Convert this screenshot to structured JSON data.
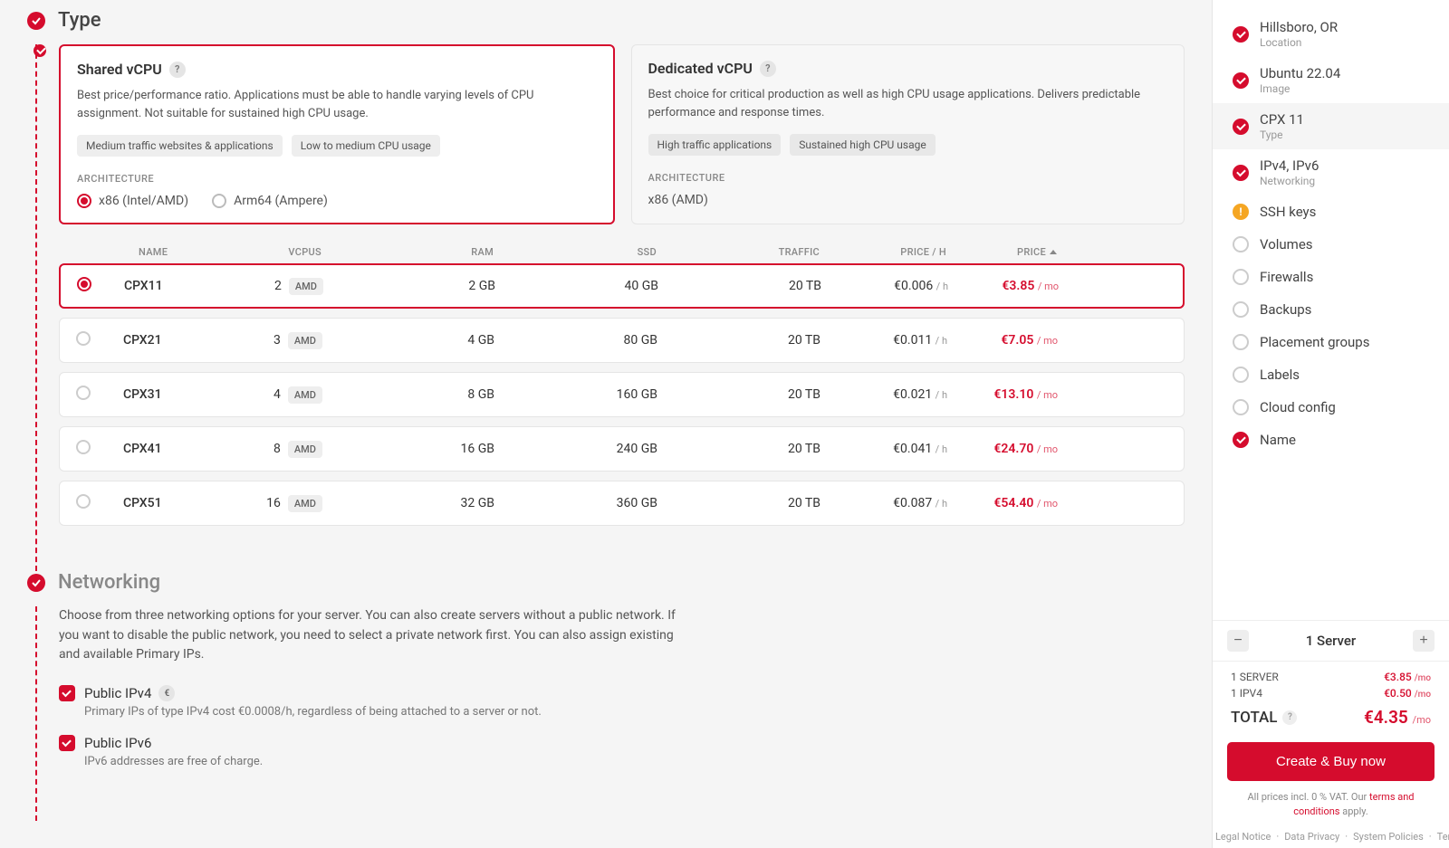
{
  "sections": {
    "type": {
      "title": "Type"
    },
    "networking": {
      "title": "Networking",
      "intro": "Choose from three networking options for your server. You can also create servers without a public network. If you want to disable the public network, you need to select a private network first. You can also assign existing and available Primary IPs.",
      "ipv4": {
        "label": "Public IPv4",
        "sub": "Primary IPs of type IPv4 cost €0.0008/h, regardless of being attached to a server or not."
      },
      "ipv6": {
        "label": "Public IPv6",
        "sub": "IPv6 addresses are free of charge."
      }
    }
  },
  "cards": {
    "shared": {
      "title": "Shared vCPU",
      "desc": "Best price/performance ratio. Applications must be able to handle varying levels of CPU assignment. Not suitable for sustained high CPU usage.",
      "chips": [
        "Medium traffic websites & applications",
        "Low to medium CPU usage"
      ],
      "arch_label": "ARCHITECTURE",
      "arch_opts": [
        "x86 (Intel/AMD)",
        "Arm64 (Ampere)"
      ]
    },
    "dedicated": {
      "title": "Dedicated vCPU",
      "desc": "Best choice for critical production as well as high CPU usage applications. Delivers predictable performance and response times.",
      "chips": [
        "High traffic applications",
        "Sustained high CPU usage"
      ],
      "arch_label": "ARCHITECTURE",
      "arch_single": "x86 (AMD)"
    }
  },
  "table": {
    "headers": {
      "name": "NAME",
      "vcpus": "VCPUS",
      "ram": "RAM",
      "ssd": "SSD",
      "traffic": "TRAFFIC",
      "price_h": "PRICE / H",
      "price": "PRICE"
    },
    "rows": [
      {
        "name": "CPX11",
        "vcpu": "2",
        "vendor": "AMD",
        "ram": "2 GB",
        "ssd": "40 GB",
        "traffic": "20 TB",
        "ph": "€0.006",
        "ph_u": "/ h",
        "pm": "€3.85",
        "pm_u": "/ mo",
        "selected": true
      },
      {
        "name": "CPX21",
        "vcpu": "3",
        "vendor": "AMD",
        "ram": "4 GB",
        "ssd": "80 GB",
        "traffic": "20 TB",
        "ph": "€0.011",
        "ph_u": "/ h",
        "pm": "€7.05",
        "pm_u": "/ mo",
        "selected": false
      },
      {
        "name": "CPX31",
        "vcpu": "4",
        "vendor": "AMD",
        "ram": "8 GB",
        "ssd": "160 GB",
        "traffic": "20 TB",
        "ph": "€0.021",
        "ph_u": "/ h",
        "pm": "€13.10",
        "pm_u": "/ mo",
        "selected": false
      },
      {
        "name": "CPX41",
        "vcpu": "8",
        "vendor": "AMD",
        "ram": "16 GB",
        "ssd": "240 GB",
        "traffic": "20 TB",
        "ph": "€0.041",
        "ph_u": "/ h",
        "pm": "€24.70",
        "pm_u": "/ mo",
        "selected": false
      },
      {
        "name": "CPX51",
        "vcpu": "16",
        "vendor": "AMD",
        "ram": "32 GB",
        "ssd": "360 GB",
        "traffic": "20 TB",
        "ph": "€0.087",
        "ph_u": "/ h",
        "pm": "€54.40",
        "pm_u": "/ mo",
        "selected": false
      }
    ]
  },
  "sidebar": {
    "items": [
      {
        "title": "Hillsboro, OR",
        "sub": "Location",
        "state": "done"
      },
      {
        "title": "Ubuntu 22.04",
        "sub": "Image",
        "state": "done"
      },
      {
        "title": "CPX 11",
        "sub": "Type",
        "state": "done",
        "active": true
      },
      {
        "title": "IPv4, IPv6",
        "sub": "Networking",
        "state": "done"
      },
      {
        "title": "SSH keys",
        "sub": "",
        "state": "warn"
      },
      {
        "title": "Volumes",
        "sub": "",
        "state": "empty"
      },
      {
        "title": "Firewalls",
        "sub": "",
        "state": "empty"
      },
      {
        "title": "Backups",
        "sub": "",
        "state": "empty"
      },
      {
        "title": "Placement groups",
        "sub": "",
        "state": "empty"
      },
      {
        "title": "Labels",
        "sub": "",
        "state": "empty"
      },
      {
        "title": "Cloud config",
        "sub": "",
        "state": "empty"
      },
      {
        "title": "Name",
        "sub": "",
        "state": "done"
      }
    ],
    "qty_label": "1 Server",
    "lines": [
      {
        "label": "1 SERVER",
        "price": "€3.85",
        "unit": "/mo"
      },
      {
        "label": "1 IPV4",
        "price": "€0.50",
        "unit": "/mo"
      }
    ],
    "total_label": "TOTAL",
    "total_price": "€4.35",
    "total_unit": "/mo",
    "cta": "Create & Buy now",
    "vat_pre": "All prices incl. 0 % VAT. Our ",
    "vat_link": "terms and conditions",
    "vat_post": " apply.",
    "legal": [
      "Legal Notice",
      "Data Privacy",
      "System Policies",
      "Terms and Conditions"
    ]
  }
}
